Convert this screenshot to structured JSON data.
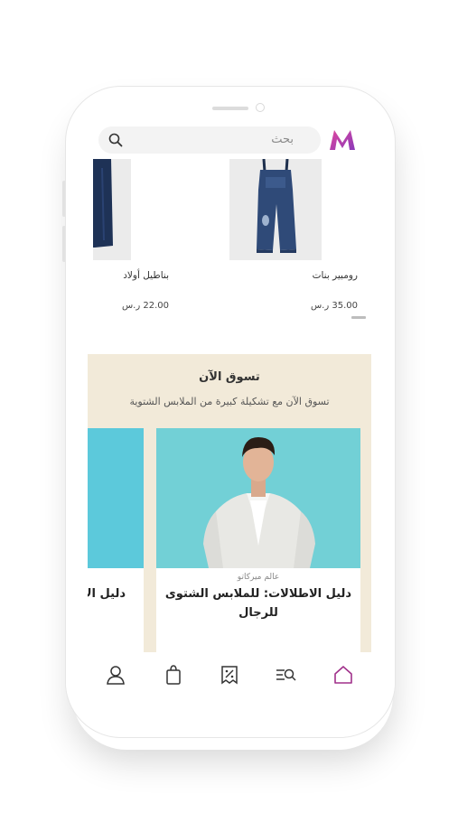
{
  "search": {
    "placeholder": "بحث"
  },
  "brand": {
    "accent": "#c2389b"
  },
  "products": [
    {
      "name": "رومبير بنات",
      "price": "35.00 ر.س"
    },
    {
      "name": "بناطيل أولاد",
      "price": "22.00 ر.س"
    }
  ],
  "promo": {
    "title": "تسوق الآن",
    "subtitle": "تسوق الآن مع تشكيلة كبيرة من الملابس الشتوية",
    "cards": [
      {
        "tag": "عالم ميركاتو",
        "title": "دليل الاطلالات: للملابس الشتوى للرجال"
      },
      {
        "title": "دليل الا"
      }
    ]
  },
  "tabbar": {
    "items": [
      "home-icon",
      "categories-icon",
      "offers-icon",
      "bag-icon",
      "profile-icon"
    ],
    "active": "home-icon",
    "active_color": "#a0308a"
  }
}
